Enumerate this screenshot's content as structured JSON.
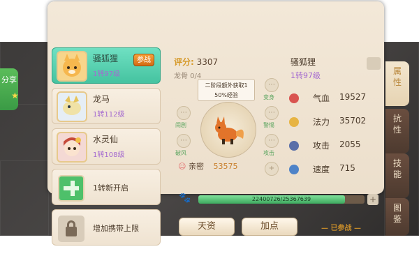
{
  "left_share": {
    "label": "分享"
  },
  "pets": [
    {
      "name": "骚狐狸",
      "level": "1转97级",
      "badge": "参战",
      "active": true
    },
    {
      "name": "龙马",
      "level": "1转112级",
      "active": false
    },
    {
      "name": "水灵仙",
      "level": "1转108级",
      "active": false
    }
  ],
  "unlock": {
    "label": "1转新开启"
  },
  "lock": {
    "label": "增加携带上限"
  },
  "center": {
    "rating_label": "评分:",
    "rating_value": "3307",
    "dragon_soul": "龙骨 0/4",
    "tooltip_line1": "二阶段额外获取1",
    "tooltip_line2": "50%经验",
    "skills": [
      "闹剧",
      "破风",
      "变身",
      "警惕",
      "攻击"
    ],
    "intimacy_label": "亲密",
    "intimacy_value": "53575"
  },
  "stats_header": {
    "name": "骚狐狸",
    "level": "1转97级"
  },
  "stats": [
    {
      "label": "气血",
      "value": "19527",
      "icon": "heart-icon",
      "color": "#d9534f"
    },
    {
      "label": "法力",
      "value": "35702",
      "icon": "mana-icon",
      "color": "#e7b443"
    },
    {
      "label": "攻击",
      "value": "2055",
      "icon": "attack-icon",
      "color": "#5a6fa8"
    },
    {
      "label": "速度",
      "value": "715",
      "icon": "speed-icon",
      "color": "#4e83c8"
    }
  ],
  "exp": {
    "text": "22400726/25367639",
    "ratio": 0.883
  },
  "buttons": {
    "talent": "天资",
    "add_point": "加点",
    "joined": "已参战"
  },
  "side_tabs": [
    "属性",
    "抗性",
    "技能",
    "图鉴"
  ]
}
